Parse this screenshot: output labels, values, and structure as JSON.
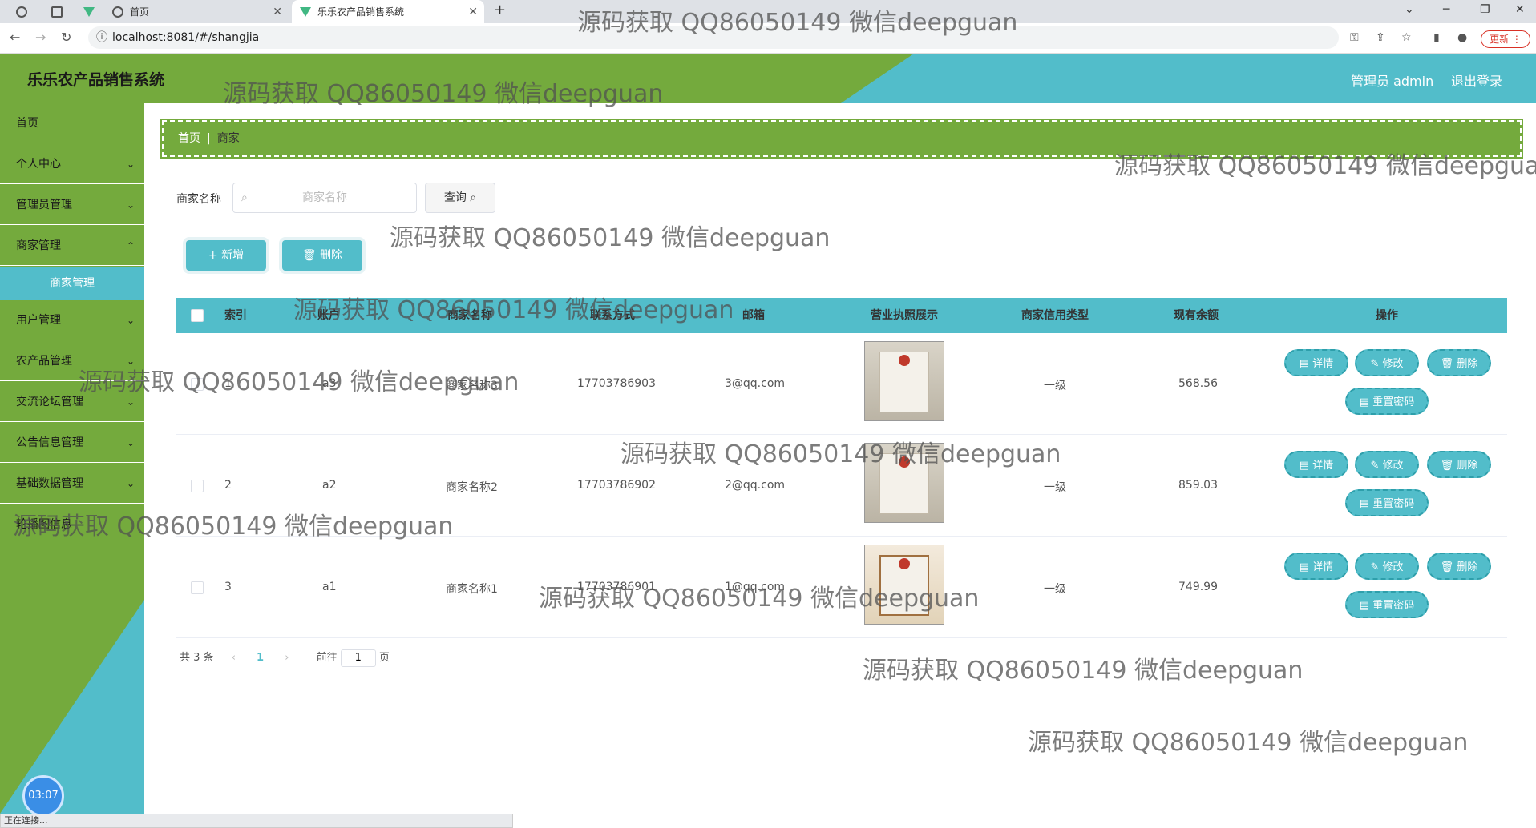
{
  "browser": {
    "tabs": [
      {
        "label": ""
      },
      {
        "label": ""
      },
      {
        "label": ""
      },
      {
        "label": "首页"
      },
      {
        "label": "乐乐农产品销售系统"
      }
    ],
    "url": "localhost:8081/#/shangjia",
    "update_label": "更新",
    "status": "正在连接..."
  },
  "header": {
    "title": "乐乐农产品销售系统",
    "user": "管理员 admin",
    "logout": "退出登录"
  },
  "sidebar": {
    "items": [
      {
        "label": "首页"
      },
      {
        "label": "个人中心"
      },
      {
        "label": "管理员管理"
      },
      {
        "label": "商家管理"
      },
      {
        "label": "商家管理"
      },
      {
        "label": "用户管理"
      },
      {
        "label": "农产品管理"
      },
      {
        "label": "交流论坛管理"
      },
      {
        "label": "公告信息管理"
      },
      {
        "label": "基础数据管理"
      },
      {
        "label": "轮播图信息"
      }
    ],
    "clock": "03:07"
  },
  "breadcrumb": {
    "home": "首页",
    "current": "商家"
  },
  "search": {
    "label": "商家名称",
    "placeholder": "商家名称",
    "query": "查询"
  },
  "actions": {
    "add": "+ 新增",
    "delete": "删除"
  },
  "table": {
    "headers": [
      "索引",
      "账户",
      "商家名称",
      "联系方式",
      "邮箱",
      "营业执照展示",
      "商家信用类型",
      "现有余额",
      "操作"
    ],
    "rows": [
      {
        "index": "1",
        "account": "a3",
        "name": "商家名称3",
        "phone": "17703786903",
        "email": "3@qq.com",
        "credit": "一级",
        "balance": "568.56"
      },
      {
        "index": "2",
        "account": "a2",
        "name": "商家名称2",
        "phone": "17703786902",
        "email": "2@qq.com",
        "credit": "一级",
        "balance": "859.03"
      },
      {
        "index": "3",
        "account": "a1",
        "name": "商家名称1",
        "phone": "17703786901",
        "email": "1@qq.com",
        "credit": "一级",
        "balance": "749.99"
      }
    ],
    "ops": {
      "detail": "详情",
      "edit": "修改",
      "delete": "删除",
      "reset": "重置密码"
    }
  },
  "pager": {
    "total": "共 3 条",
    "current": "1",
    "goto": "前往",
    "page_input": "1",
    "page_unit": "页"
  },
  "watermark": "源码获取 QQ86050149 微信deepguan",
  "colors": {
    "green": "#74aa3d",
    "teal": "#52bdca"
  }
}
